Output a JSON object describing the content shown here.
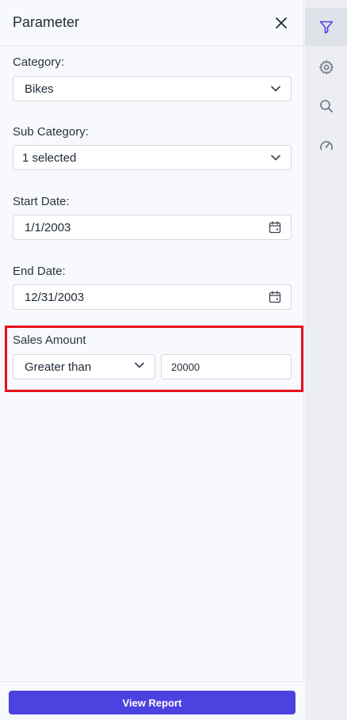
{
  "panel": {
    "title": "Parameter"
  },
  "fields": {
    "category": {
      "label": "Category:",
      "value": "Bikes"
    },
    "sub_category": {
      "label": "Sub Category:",
      "value": "1 selected"
    },
    "start_date": {
      "label": "Start Date:",
      "value": "1/1/2003"
    },
    "end_date": {
      "label": "End Date:",
      "value": "12/31/2003"
    },
    "sales_amount": {
      "label": "Sales Amount",
      "operator": "Greater than",
      "value": "20000"
    }
  },
  "footer": {
    "view_report_label": "View Report"
  },
  "rail": {
    "items": [
      {
        "icon": "filter-icon",
        "active": true
      },
      {
        "icon": "gear-icon",
        "active": false
      },
      {
        "icon": "search-icon",
        "active": false
      },
      {
        "icon": "gauge-icon",
        "active": false
      }
    ]
  },
  "colors": {
    "accent": "#4c42e0",
    "highlight": "#e8101a",
    "rail_active_icon": "#4c42e0",
    "rail_icon": "#6b7280"
  }
}
